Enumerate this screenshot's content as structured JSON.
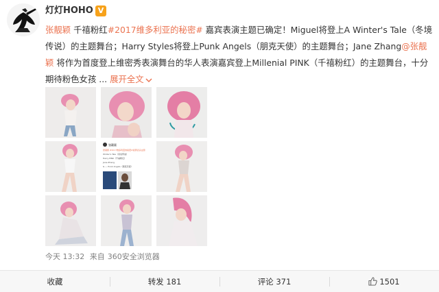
{
  "post": {
    "username": "灯灯HOHO",
    "vip_badge": "V",
    "mention_1": "张靓颖",
    "text_1": " 千禧粉红",
    "topic": "#2017维多利亚的秘密#",
    "text_2": " 嘉宾表演主题已确定！Miguel将登上A Winter's Tale（冬境传说）的主题舞台；Harry Styles将登上Punk Angels（朋克天使）的主题舞台；Jane Zhang",
    "mention_2": "@张靓颖",
    "text_3": " 将作为首度登上维密秀表演舞台的华人表演嘉宾登上Millenial PINK（千禧粉红）的主题舞台，十分期待粉色女孩 ...",
    "expand_label": "展开全文",
    "expand_icon": "chevron-down",
    "images": [
      {
        "label": "photo-1"
      },
      {
        "label": "photo-2"
      },
      {
        "label": "photo-3"
      },
      {
        "label": "photo-4"
      },
      {
        "label": "photo-5-screenshot"
      },
      {
        "label": "photo-6"
      },
      {
        "label": "photo-7"
      },
      {
        "label": "photo-8"
      },
      {
        "label": "photo-9"
      }
    ],
    "screenshot_lines": [
      "张靓颖",
      "张靓颖 #2017维多利亚的秘密#嘉宾表演主题",
      "Winter's Tale（冬境传说）",
      "Harry PINK（千禧粉红）",
      "Jane Zhang",
      "& — Punk Angels（朋克天使）"
    ],
    "time": "今天 13:32",
    "source_prefix": "来自",
    "source": "360安全浏览器"
  },
  "actions": {
    "collect": "收藏",
    "repost": "转发 181",
    "comment": "评论 371",
    "like": "1501"
  },
  "colors": {
    "accent": "#eb7350",
    "badge": "#f7a21b",
    "meta": "#808080",
    "pink_hair": "#e88fb1"
  }
}
